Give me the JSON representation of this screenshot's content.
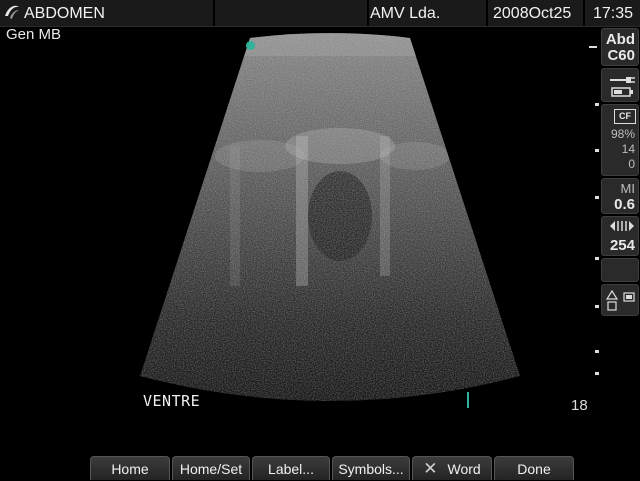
{
  "header": {
    "exam": "ABDOMEN",
    "institution": "AMV Lda.",
    "date": "2008Oct25",
    "time": "17:35"
  },
  "preset": "Gen MB",
  "image": {
    "annotation": "VENTRE",
    "depth": "18"
  },
  "side_panel": {
    "transducer_line1": "Abd",
    "transducer_line2": "C60",
    "cf_label": "CF",
    "cf_percent": "98%",
    "cf_value2": "14",
    "cf_value3": "0",
    "mi_label": "MI",
    "mi_value": "0.6",
    "line_density": "254"
  },
  "softkeys": [
    {
      "label": "Home"
    },
    {
      "label": "Home/Set"
    },
    {
      "label": "Label..."
    },
    {
      "label": "Symbols..."
    },
    {
      "label": "Word"
    },
    {
      "label": "Done"
    }
  ]
}
